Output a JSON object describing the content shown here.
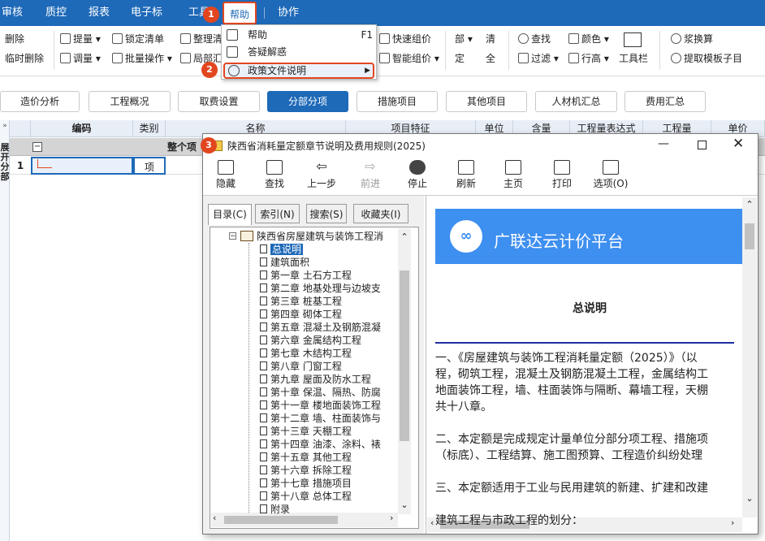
{
  "menubar": {
    "items": [
      "审核",
      "质控",
      "报表",
      "电子标",
      "工具",
      "帮助",
      "协作"
    ]
  },
  "toolbar": {
    "row1": [
      "删除",
      "提量",
      "锁定清单",
      "整理清",
      "快速组价",
      "查找",
      "颜色",
      "工具栏",
      "浆换算"
    ],
    "row2": [
      "临时删除",
      "调量",
      "批量操作",
      "局部汇",
      "智能组价",
      "过滤",
      "行高",
      "提取模板子目"
    ]
  },
  "help_menu": {
    "items": [
      "帮助",
      "答疑解惑",
      "政策文件说明"
    ],
    "shortcut": "F1"
  },
  "badges": [
    "1",
    "2",
    "3"
  ],
  "tabs": [
    "造价分析",
    "工程概况",
    "取费设置",
    "分部分项",
    "措施项目",
    "其他项目",
    "人材机汇总",
    "费用汇总"
  ],
  "grid": {
    "headers": [
      "编码",
      "类别",
      "名称",
      "项目特征",
      "单位",
      "含量",
      "工程量表达式",
      "工程量",
      "单价"
    ],
    "row_group": "整个项",
    "row1": {
      "num": "1",
      "type": "项"
    },
    "side_label": "展开分部"
  },
  "help_window": {
    "title": "陕西省消耗量定额章节说明及费用规则(2025)",
    "toolbar": [
      "隐藏",
      "查找",
      "上一步",
      "前进",
      "停止",
      "刷新",
      "主页",
      "打印",
      "选项(O)"
    ],
    "panel_tabs": [
      "目录(C)",
      "索引(N)",
      "搜索(S)",
      "收藏夹(I)"
    ],
    "tree_root": "陕西省房屋建筑与装饰工程消",
    "tree_items": [
      "总说明",
      "建筑面积",
      "第一章 土石方工程",
      "第二章 地基处理与边坡支",
      "第三章 桩基工程",
      "第四章 砌体工程",
      "第五章 混凝土及钢筋混凝",
      "第六章 金属结构工程",
      "第七章 木结构工程",
      "第八章 门窗工程",
      "第九章 屋面及防水工程",
      "第十章 保温、隔热、防腐",
      "第十一章 楼地面装饰工程",
      "第十二章 墙、柱面装饰与",
      "第十三章 天棚工程",
      "第十四章 油漆、涂料、裱",
      "第十五章 其他工程",
      "第十六章 拆除工程",
      "第十七章 措施项目",
      "第十八章 总体工程",
      "附录"
    ],
    "brand": "广联达云计价平台",
    "doc_title": "总说明",
    "paragraphs": [
      "一、《房屋建筑与装饰工程消耗量定额（2025）》（以",
      "程，砌筑工程，混凝土及钢筋混凝土工程，金属结构工",
      "地面装饰工程，墙、柱面装饰与隔断、幕墙工程，天棚",
      "共十八章。",
      "",
      "二、本定额是完成规定计量单位分部分项工程、措施项",
      "（标底）、工程结算、施工图预算、工程造价纠纷处理",
      "",
      "三、本定额适用于工业与民用建筑的新建、扩建和改建",
      "",
      "建筑工程与市政工程的划分："
    ]
  },
  "colors": {
    "accent": "#1e69b8",
    "highlight": "#e2461f",
    "banner": "#3d8ff0"
  }
}
